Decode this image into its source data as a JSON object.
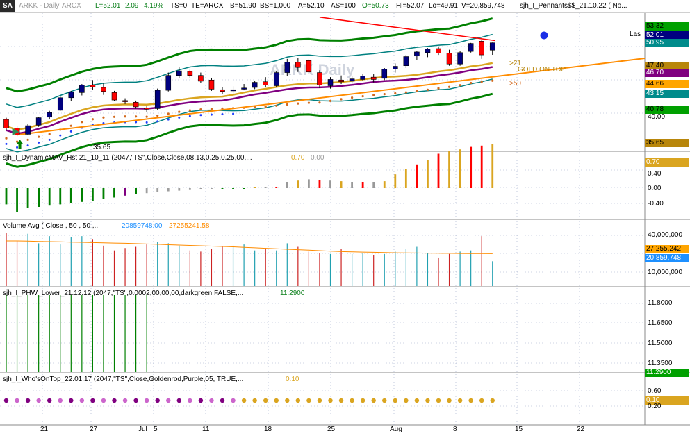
{
  "header": {
    "badge": "SA",
    "symbol": "ARKK - Daily",
    "exchange": "ARCX",
    "last": "L=52.01",
    "change": "2.09",
    "change_pct": "4.19%",
    "ts": "TS=0",
    "te": "TE=ARCX",
    "bid": "B=51.90",
    "bid_size": "BS=1,000",
    "ask": "A=52.10",
    "ask_size": "AS=100",
    "open": "O=50.73",
    "high": "Hi=52.07",
    "low": "Lo=49.91",
    "volume": "V=20,859,748",
    "study": "sjh_I_Pennants$$_21.10.22 ( No..."
  },
  "colors": {
    "up_candle": "#000080",
    "down_candle": "#ff0000",
    "bollinger": "#008000",
    "keltner": "#008080",
    "goldenrod": "#daa520",
    "purple": "#800080",
    "trend_orange": "#ff8c00",
    "resistance_red": "#ff0000"
  },
  "watermark": "ARKK Daily",
  "price_panel": {
    "low_annotation": "35.65",
    "label_gt21": ">21",
    "label_gold": "GOLD ON TOP",
    "label_gt50": ">50",
    "last_label": "Las",
    "axis_tags": [
      {
        "text": "53.32",
        "bg": "#00a000",
        "fg": "#000000"
      },
      {
        "text": "52.01",
        "bg": "#000080",
        "fg": "#ffffff"
      },
      {
        "text": "50.95",
        "bg": "#008b8b",
        "fg": "#ffffff"
      },
      {
        "text": "47.40",
        "bg": "#b8860b",
        "fg": "#000000"
      },
      {
        "text": "46.70",
        "bg": "#800080",
        "fg": "#ffffff"
      },
      {
        "text": "44.66",
        "bg": "#ffa500",
        "fg": "#000000"
      },
      {
        "text": "43.15",
        "bg": "#008b8b",
        "fg": "#ffffff"
      },
      {
        "text": "40.78",
        "bg": "#00a000",
        "fg": "#000000"
      },
      {
        "text": "35.65",
        "bg": "#b8860b",
        "fg": "#000000"
      }
    ],
    "axis_ticks": [
      "40.00"
    ]
  },
  "dmav_panel": {
    "title": "sjh_I_DynamicMAV_Hst 21_10_11 (2047,\"TS\",Close,Close,08,13,0.25,0.25,00,...",
    "value1": "0.70",
    "value2": "0.00",
    "axis_tag": {
      "text": "0.70",
      "bg": "#daa520",
      "fg": "#ffffff"
    },
    "axis_ticks": [
      "0.40",
      "0.00",
      "-0.40"
    ]
  },
  "volume_panel": {
    "title": "Volume Avg ( Close , 50 , 50 ,...",
    "value1": "20859748.00",
    "value2": "27255241.58",
    "axis_ticks": [
      "40,000,000",
      "10,000,000"
    ],
    "axis_tags": [
      {
        "text": "27,255,242",
        "bg": "#ffa500",
        "fg": "#000000"
      },
      {
        "text": "20,859,748",
        "bg": "#1e90ff",
        "fg": "#ffffff"
      }
    ]
  },
  "phw_panel": {
    "title": "sjh_I_PHW_Lower_21.12.12 (2047,\"TS\",0.0002,00,00,00,darkgreen,FALSE,...",
    "value1": "11.2900",
    "axis_ticks": [
      "11.8000",
      "11.6500",
      "11.5000",
      "11.3500"
    ],
    "axis_tag": {
      "text": "11.2900",
      "bg": "#00a000",
      "fg": "#ffffff"
    }
  },
  "wot_panel": {
    "title": "sjh_I_Who'sOnTop_22.01.17 (2047,\"TS\",Close,Goldenrod,Purple,05, TRUE,...",
    "value1": "0.10",
    "axis_ticks": [
      "0.60",
      "0.20"
    ],
    "axis_tag": {
      "text": "0.10",
      "bg": "#daa520",
      "fg": "#ffffff"
    }
  },
  "x_axis": {
    "labels": [
      "21",
      "27",
      "Jul",
      "5",
      "11",
      "18",
      "25",
      "Aug",
      "8",
      "15",
      "22"
    ]
  },
  "chart_data": {
    "type": "candlestick",
    "candles": [
      {
        "o": 38.6,
        "h": 38.9,
        "l": 36.8,
        "c": 37.1
      },
      {
        "o": 37.1,
        "h": 37.4,
        "l": 35.65,
        "c": 35.9
      },
      {
        "o": 36.0,
        "h": 37.8,
        "l": 35.9,
        "c": 37.5
      },
      {
        "o": 37.6,
        "h": 39.0,
        "l": 37.3,
        "c": 38.9
      },
      {
        "o": 39.0,
        "h": 40.1,
        "l": 38.6,
        "c": 39.8
      },
      {
        "o": 40.2,
        "h": 42.6,
        "l": 40.1,
        "c": 42.4
      },
      {
        "o": 42.4,
        "h": 43.6,
        "l": 41.8,
        "c": 43.4
      },
      {
        "o": 43.3,
        "h": 44.8,
        "l": 42.8,
        "c": 44.6
      },
      {
        "o": 44.6,
        "h": 45.5,
        "l": 43.8,
        "c": 44.3
      },
      {
        "o": 44.2,
        "h": 44.9,
        "l": 42.9,
        "c": 43.5
      },
      {
        "o": 43.3,
        "h": 43.6,
        "l": 41.8,
        "c": 42.0
      },
      {
        "o": 41.9,
        "h": 42.3,
        "l": 41.3,
        "c": 41.7
      },
      {
        "o": 41.6,
        "h": 41.9,
        "l": 40.5,
        "c": 40.8
      },
      {
        "o": 40.6,
        "h": 41.0,
        "l": 39.9,
        "c": 40.4
      },
      {
        "o": 40.5,
        "h": 44.0,
        "l": 40.2,
        "c": 43.7
      },
      {
        "o": 43.7,
        "h": 46.8,
        "l": 43.5,
        "c": 46.3
      },
      {
        "o": 46.3,
        "h": 47.8,
        "l": 45.8,
        "c": 47.1
      },
      {
        "o": 47.0,
        "h": 47.3,
        "l": 45.9,
        "c": 46.3
      },
      {
        "o": 46.3,
        "h": 46.8,
        "l": 45.0,
        "c": 45.3
      },
      {
        "o": 45.5,
        "h": 45.9,
        "l": 43.6,
        "c": 43.9
      },
      {
        "o": 43.8,
        "h": 44.3,
        "l": 43.0,
        "c": 43.5
      },
      {
        "o": 43.6,
        "h": 44.4,
        "l": 42.9,
        "c": 43.8
      },
      {
        "o": 43.9,
        "h": 44.8,
        "l": 43.7,
        "c": 44.1
      },
      {
        "o": 44.2,
        "h": 45.3,
        "l": 43.9,
        "c": 45.1
      },
      {
        "o": 45.2,
        "h": 46.0,
        "l": 44.3,
        "c": 44.6
      },
      {
        "o": 44.5,
        "h": 47.1,
        "l": 44.3,
        "c": 46.8
      },
      {
        "o": 46.8,
        "h": 49.2,
        "l": 46.2,
        "c": 48.6
      },
      {
        "o": 48.6,
        "h": 49.3,
        "l": 46.9,
        "c": 47.7
      },
      {
        "o": 48.9,
        "h": 49.1,
        "l": 46.6,
        "c": 46.9
      },
      {
        "o": 46.8,
        "h": 47.2,
        "l": 44.1,
        "c": 44.6
      },
      {
        "o": 44.5,
        "h": 46.0,
        "l": 44.0,
        "c": 45.6
      },
      {
        "o": 45.5,
        "h": 46.3,
        "l": 44.8,
        "c": 45.2
      },
      {
        "o": 45.3,
        "h": 46.2,
        "l": 44.9,
        "c": 45.7
      },
      {
        "o": 45.6,
        "h": 46.6,
        "l": 45.3,
        "c": 46.2
      },
      {
        "o": 46.0,
        "h": 46.5,
        "l": 45.1,
        "c": 45.6
      },
      {
        "o": 45.8,
        "h": 47.6,
        "l": 45.5,
        "c": 47.4
      },
      {
        "o": 47.4,
        "h": 48.4,
        "l": 46.8,
        "c": 47.9
      },
      {
        "o": 48.0,
        "h": 49.9,
        "l": 47.6,
        "c": 49.6
      },
      {
        "o": 49.7,
        "h": 50.6,
        "l": 49.0,
        "c": 50.4
      },
      {
        "o": 50.3,
        "h": 51.1,
        "l": 49.5,
        "c": 50.9
      },
      {
        "o": 51.0,
        "h": 51.4,
        "l": 49.9,
        "c": 50.2
      },
      {
        "o": 50.2,
        "h": 50.8,
        "l": 48.0,
        "c": 48.3
      },
      {
        "o": 48.3,
        "h": 50.6,
        "l": 48.0,
        "c": 50.3
      },
      {
        "o": 50.5,
        "h": 52.0,
        "l": 50.3,
        "c": 51.9
      },
      {
        "o": 52.3,
        "h": 52.6,
        "l": 49.2,
        "c": 49.9
      },
      {
        "o": 50.73,
        "h": 52.07,
        "l": 49.91,
        "c": 52.01
      }
    ],
    "dmav_hist": [
      -0.26,
      -0.38,
      -0.32,
      -0.3,
      -0.28,
      -0.26,
      -0.24,
      -0.22,
      -0.2,
      -0.17,
      -0.15,
      -0.12,
      -0.1,
      -0.08,
      -0.06,
      -0.05,
      -0.04,
      -0.03,
      -0.02,
      -0.02,
      -0.01,
      -0.01,
      -0.01,
      0.0,
      0.0,
      0.0,
      0.1,
      0.12,
      0.14,
      0.13,
      0.12,
      0.11,
      0.1,
      0.1,
      0.1,
      0.11,
      0.22,
      0.3,
      0.38,
      0.45,
      0.55,
      0.6,
      0.62,
      0.66,
      0.68,
      0.7
    ],
    "volume": [
      45,
      38,
      44,
      36,
      42,
      35,
      41,
      42,
      39,
      34,
      30,
      32,
      33,
      35,
      37,
      36,
      34,
      30,
      29,
      31,
      33,
      34,
      35,
      30,
      32,
      30,
      36,
      33,
      29,
      28,
      27,
      31,
      27,
      28,
      26,
      27,
      29,
      31,
      33,
      28,
      24,
      27,
      29,
      30,
      42,
      20.86
    ],
    "volume_avg": [
      38,
      38,
      37.8,
      37.6,
      37.4,
      37.2,
      37,
      36.8,
      36.6,
      36.4,
      36.2,
      36,
      35.7,
      35.4,
      35.1,
      34.8,
      34.5,
      34.2,
      33.9,
      33.6,
      33.3,
      33,
      32.6,
      32.2,
      31.8,
      31.4,
      31,
      30.6,
      30.2,
      29.8,
      29.4,
      29.0,
      28.8,
      28.6,
      28.4,
      28.2,
      28.0,
      27.9,
      27.8,
      27.7,
      27.6,
      27.5,
      27.4,
      27.35,
      27.3,
      27.26
    ],
    "phw": [
      11.9,
      11.9,
      11.9,
      11.9,
      11.9,
      11.9,
      11.9,
      11.9,
      11.9,
      11.9,
      11.9,
      11.9,
      11.9,
      11.9,
      0,
      0,
      0,
      0,
      0,
      0,
      0,
      0,
      0,
      0,
      0,
      0,
      0,
      0,
      0,
      0,
      0,
      0,
      0,
      0,
      0,
      0,
      0,
      0,
      0,
      0,
      0,
      0,
      0,
      0,
      0,
      0
    ],
    "wot_color_switch_index": 22,
    "x_labels": [
      "21",
      "27",
      "Jul",
      "5",
      "11",
      "18",
      "25",
      "Aug",
      "8",
      "15",
      "22"
    ],
    "y_range_price": [
      33.5,
      55.5
    ]
  }
}
